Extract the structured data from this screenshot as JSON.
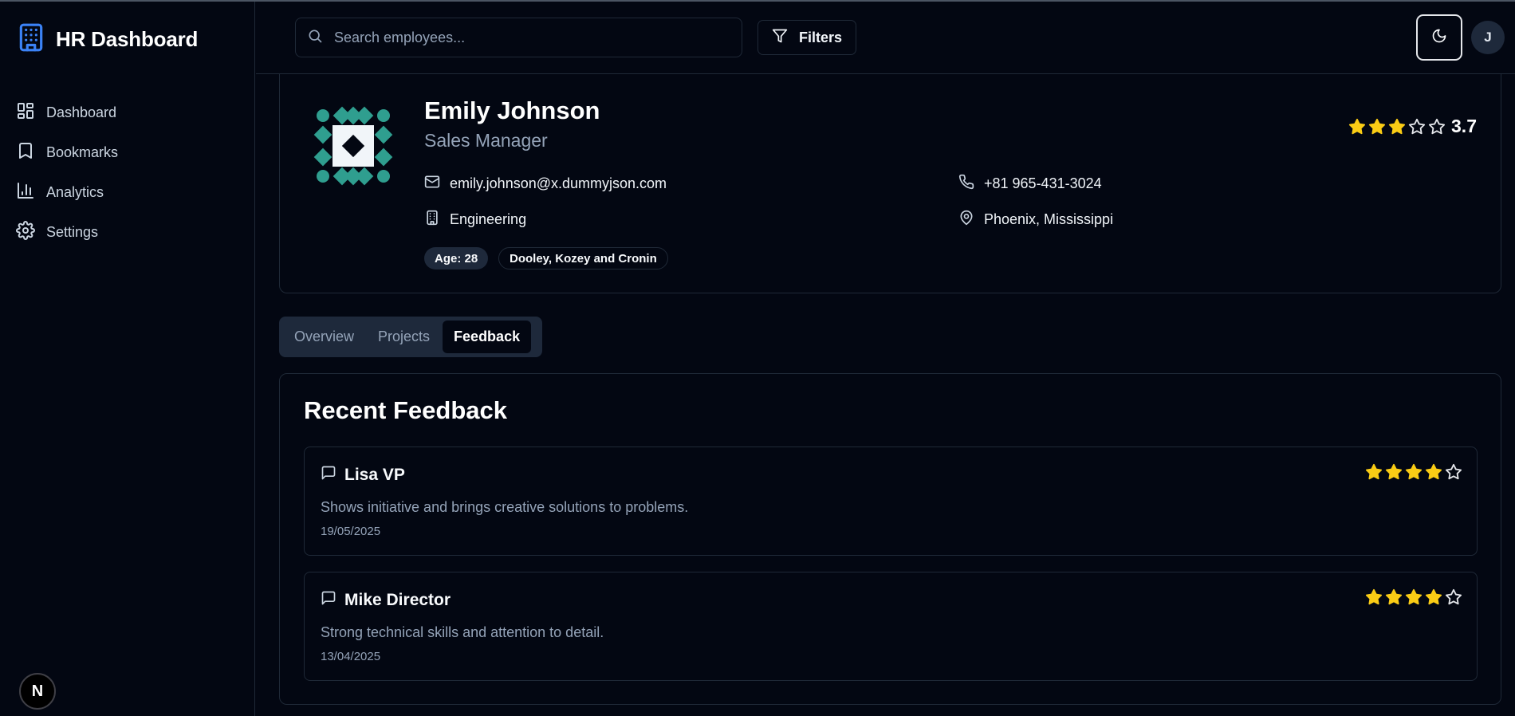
{
  "app": {
    "title": "HR Dashboard"
  },
  "sidebar": {
    "items": [
      {
        "label": "Dashboard",
        "icon": "dashboard-icon"
      },
      {
        "label": "Bookmarks",
        "icon": "bookmark-icon"
      },
      {
        "label": "Analytics",
        "icon": "bar-chart-icon"
      },
      {
        "label": "Settings",
        "icon": "gear-icon"
      }
    ],
    "framework_badge": "N"
  },
  "header": {
    "search_placeholder": "Search employees...",
    "filters_label": "Filters",
    "theme_icon": "moon-icon",
    "avatar_initial": "J"
  },
  "profile": {
    "name": "Emily Johnson",
    "title": "Sales Manager",
    "email": "emily.johnson@x.dummyjson.com",
    "phone": "+81 965-431-3024",
    "department": "Engineering",
    "location": "Phoenix, Mississippi",
    "age_badge": "Age: 28",
    "company_badge": "Dooley, Kozey and Cronin",
    "rating": 3.7,
    "rating_label": "3.7",
    "rating_filled_stars": 3,
    "rating_max": 5
  },
  "tabs": [
    {
      "label": "Overview",
      "active": false
    },
    {
      "label": "Projects",
      "active": false
    },
    {
      "label": "Feedback",
      "active": true
    }
  ],
  "feedback": {
    "heading": "Recent Feedback",
    "items": [
      {
        "author": "Lisa VP",
        "text": "Shows initiative and brings creative solutions to problems.",
        "date": "19/05/2025",
        "stars": 4
      },
      {
        "author": "Mike Director",
        "text": "Strong technical skills and attention to detail.",
        "date": "13/04/2025",
        "stars": 4
      }
    ]
  },
  "colors": {
    "background": "#030712",
    "border": "#1f2937",
    "accent_blue": "#3b82f6",
    "star_yellow": "#facc15",
    "identicon_teal": "#2f9e8f",
    "muted_text": "#94a3b8"
  }
}
